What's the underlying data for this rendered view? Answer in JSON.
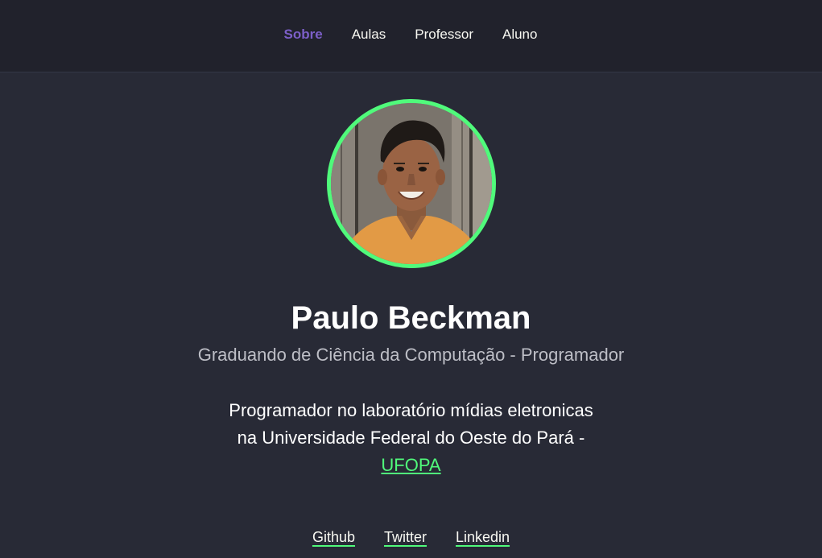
{
  "nav": {
    "items": [
      {
        "label": "Sobre",
        "active": true
      },
      {
        "label": "Aulas",
        "active": false
      },
      {
        "label": "Professor",
        "active": false
      },
      {
        "label": "Aluno",
        "active": false
      }
    ]
  },
  "profile": {
    "name": "Paulo Beckman",
    "subtitle": "Graduando de Ciência da Computação - Programador",
    "bio_line1": "Programador no laboratório mídias eletronicas",
    "bio_line2": "na Universidade Federal do Oeste do Pará -",
    "bio_link": "UFOPA"
  },
  "social": {
    "github": "Github",
    "twitter": "Twitter",
    "linkedin": "Linkedin"
  },
  "colors": {
    "background": "#282a36",
    "topbar": "#21222c",
    "accent_green": "#50fa7b",
    "accent_purple": "#7c5fc8"
  }
}
